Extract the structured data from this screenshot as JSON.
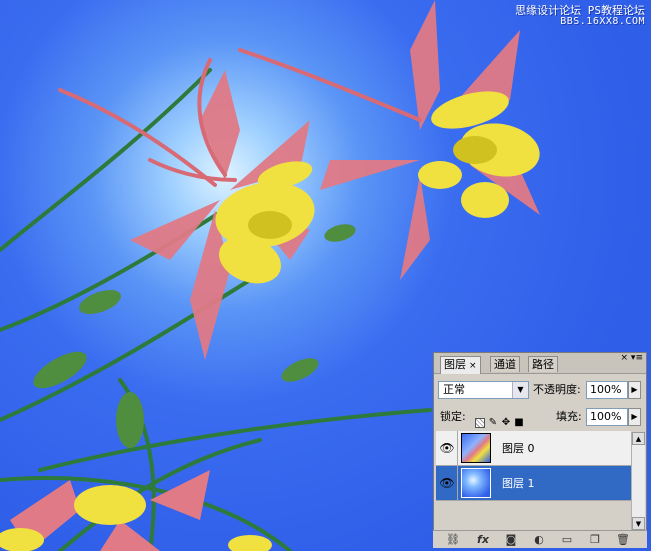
{
  "watermark": {
    "line1": "思缘设计论坛  PS教程论坛",
    "line2": "BBS.16XX8.COM"
  },
  "layers_panel": {
    "tabs": [
      {
        "label": "图层",
        "active": true
      },
      {
        "label": "通道",
        "active": false
      },
      {
        "label": "路径",
        "active": false
      }
    ],
    "tab_close": "×",
    "menu_icons": "× ▾≡",
    "blend_mode": "正常",
    "opacity_label": "不透明度:",
    "opacity_value": "100%",
    "lock_label": "锁定:",
    "fill_label": "填充:",
    "fill_value": "100%",
    "layers": [
      {
        "name": "图层 0",
        "visible": true,
        "selected": false
      },
      {
        "name": "图层 1",
        "visible": true,
        "selected": true
      }
    ],
    "footer_icons": [
      "link-icon",
      "fx-icon",
      "mask-icon",
      "adjustment-icon",
      "folder-icon",
      "new-layer-icon",
      "trash-icon"
    ]
  },
  "colors": {
    "background_blue": "#2f5ee8",
    "glow_center": "#dff3ff",
    "selection_blue": "#316ac5",
    "panel_gray": "#d4d0c8"
  }
}
